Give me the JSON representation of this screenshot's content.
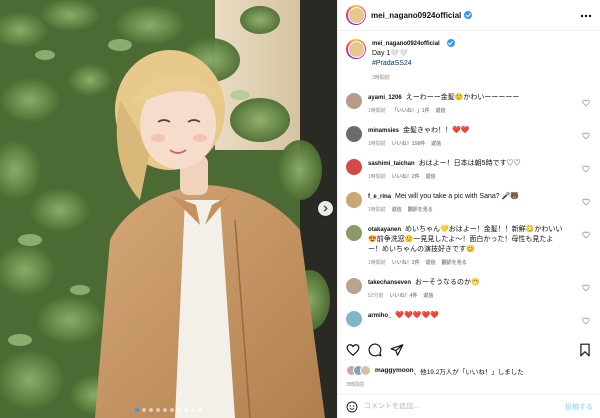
{
  "post": {
    "username": "mei_nagano0924official",
    "caption_line1": "Day 1🤍🤍",
    "caption_hashtag": "#PradaSS24",
    "caption_time": "3時間前",
    "more_icon": "ellipsis-icon",
    "photo_slide_count": 10,
    "photo_active_index": 0
  },
  "comments": [
    {
      "user": "ayami_1206",
      "text": "えーわーー金髪🙂かわいーーーーー",
      "time": "1時間前",
      "likes": "「いいね！」1件",
      "reply": "返信"
    },
    {
      "user": "minamsies",
      "text": "金髪きゃわ！！❤️❤️",
      "time": "1時間前",
      "likes": "いいね！158件",
      "reply": "返信"
    },
    {
      "user": "sashimi_taichan",
      "text": "おはよー！日本は朝5時です♡♡",
      "time": "1時間前",
      "likes": "いいね！2件",
      "reply": "返信"
    },
    {
      "user": "f_e_rina",
      "text": "Mei will you take a pic with Sana? 🎤🐻",
      "time": "1時間前",
      "likes": "返信",
      "reply": "翻訳を見る"
    },
    {
      "user": "otakayanen",
      "text": "めいちゃん💛おはよー！金髪！！新鮮😳かわいい😍前争洗窓🙂一見見したよ～！面白かった！母性も見たよー！めいちゃんの演技好きです😊",
      "time": "1時間前",
      "likes": "いいね！2件",
      "reply": "返信",
      "extra": "翻訳を見る"
    },
    {
      "user": "takechanseven",
      "text": "おーそうなるのか😁",
      "time": "52分前",
      "likes": "いいね！4件",
      "reply": "返信"
    },
    {
      "user": "armiho_",
      "text": "❤️❤️❤️❤️❤️",
      "time": "",
      "likes": "",
      "reply": ""
    }
  ],
  "actions": {
    "like_icon": "heart-icon",
    "comment_icon": "comment-icon",
    "share_icon": "share-icon",
    "save_icon": "bookmark-icon"
  },
  "likes": {
    "liked_by_user": "maggymoon",
    "text": "、他19.2万人が「いいね！」しました"
  },
  "posted_time": "3時間前",
  "add_comment": {
    "placeholder": "コメントを追加...",
    "post_label": "投稿する",
    "emoji_icon": "emoji-icon"
  },
  "colors": {
    "accent": "#3897f0",
    "heart": "#ed4956",
    "muted": "#8e8e8e",
    "hashtag": "#00376b"
  }
}
